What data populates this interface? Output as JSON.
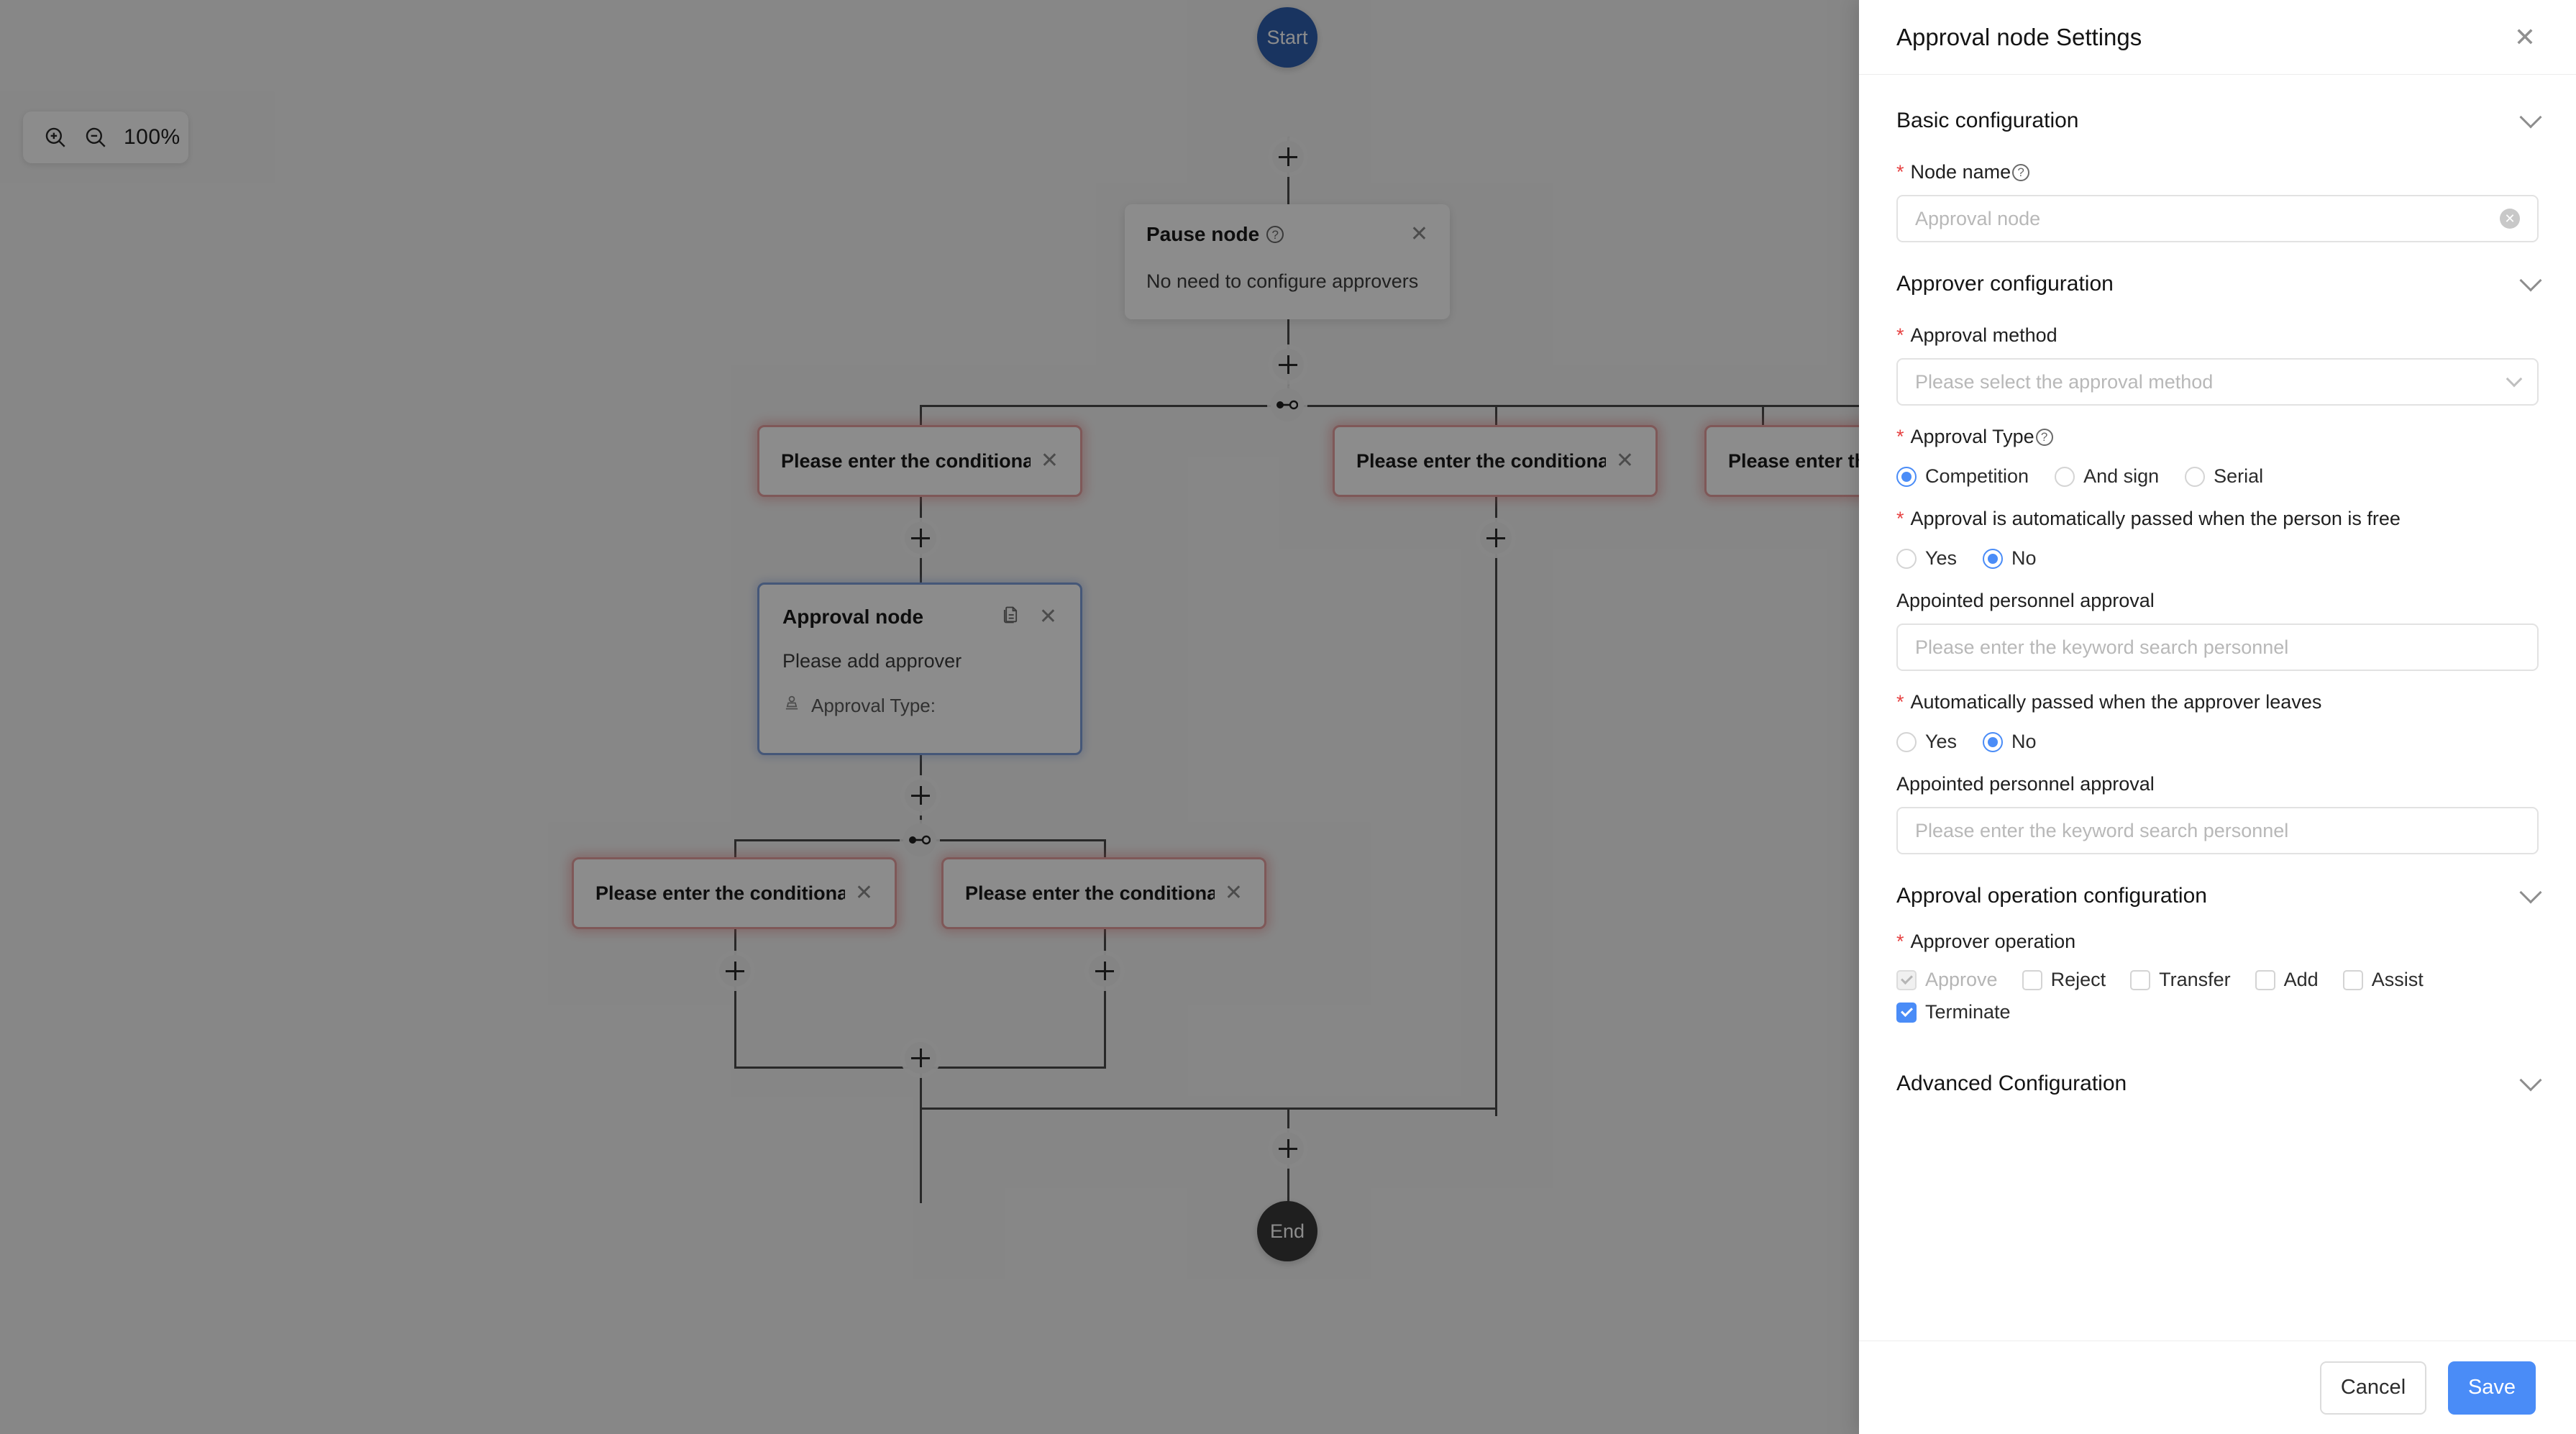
{
  "canvas": {
    "zoom_control": {
      "zoom_in_icon": "zoom-in-icon",
      "zoom_out_icon": "zoom-out-icon",
      "level": "100%"
    },
    "start_node": {
      "label": "Start"
    },
    "end_node": {
      "label": "End"
    },
    "pause_node": {
      "title": "Pause node",
      "help_icon": "question-mark-icon",
      "close_icon": "close-icon",
      "description": "No need to configure approvers"
    },
    "approval_node": {
      "title": "Approval node",
      "copy_icon": "copy-icon",
      "close_icon": "close-icon",
      "description": "Please add approver",
      "stamp_icon": "stamp-icon",
      "type_label": "Approval Type:"
    },
    "conditional_nodes": [
      {
        "label": "Please enter the conditional ...",
        "close_icon": "close-icon"
      },
      {
        "label": "Please enter the conditional ...",
        "close_icon": "close-icon"
      },
      {
        "label": "Please enter the ...",
        "close_icon": "close-icon"
      },
      {
        "label": "Please enter the conditional ...",
        "close_icon": "close-icon"
      },
      {
        "label": "Please enter the conditional ...",
        "close_icon": "close-icon"
      }
    ],
    "add_button_icon": "plus-icon",
    "branch_connector_icon": "branch-connector-icon"
  },
  "panel": {
    "title": "Approval node Settings",
    "close_icon": "close-icon",
    "chevron_icon": "chevron-down-icon",
    "sections": {
      "basic": {
        "title": "Basic configuration",
        "node_name_label": "Node name",
        "node_name_help_icon": "question-mark-icon",
        "node_name_value": "Approval node",
        "node_name_clear_icon": "clear-icon"
      },
      "approver": {
        "title": "Approver configuration",
        "approval_method_label": "Approval method",
        "approval_method_placeholder": "Please select the approval method",
        "approval_type_label": "Approval Type",
        "approval_type_help_icon": "question-mark-icon",
        "approval_type_options": [
          {
            "label": "Competition",
            "selected": true
          },
          {
            "label": "And sign",
            "selected": false
          },
          {
            "label": "Serial",
            "selected": false
          }
        ],
        "auto_pass_free_label": "Approval is automatically passed when the person is free",
        "auto_pass_free_options": [
          {
            "label": "Yes",
            "selected": false
          },
          {
            "label": "No",
            "selected": true
          }
        ],
        "appointed_personnel_label_1": "Appointed personnel approval",
        "appointed_personnel_placeholder_1": "Please enter the keyword search personnel",
        "auto_pass_leave_label": "Automatically passed when the approver leaves",
        "auto_pass_leave_options": [
          {
            "label": "Yes",
            "selected": false
          },
          {
            "label": "No",
            "selected": true
          }
        ],
        "appointed_personnel_label_2": "Appointed personnel approval",
        "appointed_personnel_placeholder_2": "Please enter the keyword search personnel"
      },
      "operation": {
        "title": "Approval operation configuration",
        "approver_operation_label": "Approver operation",
        "options": [
          {
            "label": "Approve",
            "checked": true,
            "disabled": true
          },
          {
            "label": "Reject",
            "checked": false,
            "disabled": false
          },
          {
            "label": "Transfer",
            "checked": false,
            "disabled": false
          },
          {
            "label": "Add",
            "checked": false,
            "disabled": false
          },
          {
            "label": "Assist",
            "checked": false,
            "disabled": false
          },
          {
            "label": "Terminate",
            "checked": true,
            "disabled": false
          }
        ]
      },
      "advanced": {
        "title": "Advanced Configuration"
      }
    },
    "footer": {
      "cancel_label": "Cancel",
      "save_label": "Save"
    }
  },
  "colors": {
    "accent_blue": "#4a8cf7",
    "start_blue": "#2f5fb0",
    "end_dark": "#3a3a3a",
    "error_red": "#e8a0a0",
    "required_red": "#e64242"
  }
}
